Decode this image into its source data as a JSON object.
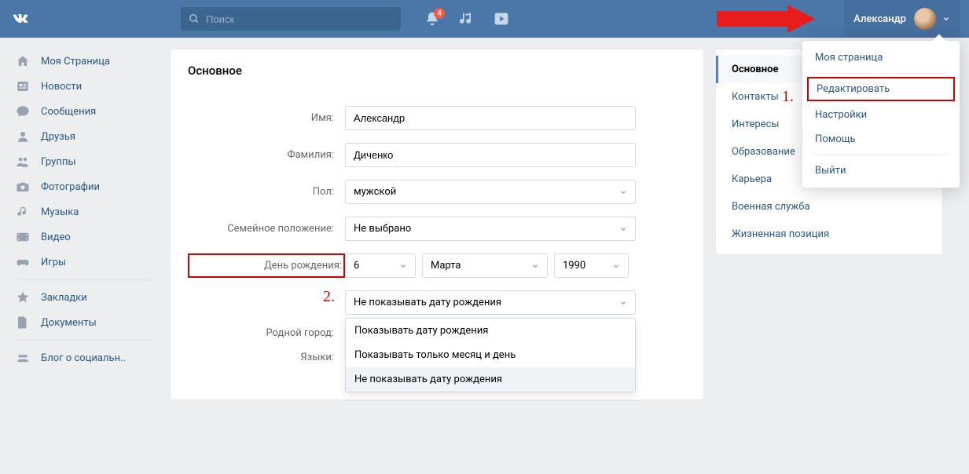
{
  "header": {
    "search_placeholder": "Поиск",
    "notif_count": "4",
    "user_name": "Александр"
  },
  "leftnav": {
    "items": [
      {
        "label": "Моя Страница",
        "icon": "home"
      },
      {
        "label": "Новости",
        "icon": "news"
      },
      {
        "label": "Сообщения",
        "icon": "messages"
      },
      {
        "label": "Друзья",
        "icon": "friends"
      },
      {
        "label": "Группы",
        "icon": "groups"
      },
      {
        "label": "Фотографии",
        "icon": "photos"
      },
      {
        "label": "Музыка",
        "icon": "music"
      },
      {
        "label": "Видео",
        "icon": "video"
      },
      {
        "label": "Игры",
        "icon": "games"
      }
    ],
    "items2": [
      {
        "label": "Закладки",
        "icon": "bookmarks"
      },
      {
        "label": "Документы",
        "icon": "docs"
      }
    ],
    "items3": [
      {
        "label": "Блог о социальн..",
        "icon": "blog"
      }
    ]
  },
  "main": {
    "title": "Основное",
    "labels": {
      "name": "Имя:",
      "surname": "Фамилия:",
      "gender": "Пол:",
      "relationship": "Семейное положение:",
      "birthday": "День рождения:",
      "hometown": "Родной город:",
      "languages": "Языки:"
    },
    "values": {
      "name": "Александр",
      "surname": "Диченко",
      "gender": "мужской",
      "relationship": "Не выбрано",
      "birth_day": "6",
      "birth_month": "Марта",
      "birth_year": "1990",
      "birth_visibility": "Не показывать дату рождения"
    },
    "dropdown_options": [
      "Показывать дату рождения",
      "Показывать только месяц и день",
      "Не показывать дату рождения"
    ]
  },
  "rightnav": {
    "items": [
      "Основное",
      "Контакты",
      "Интересы",
      "Образование",
      "Карьера",
      "Военная служба",
      "Жизненная позиция"
    ]
  },
  "user_dropdown": {
    "items": [
      "Моя страница",
      "Редактировать",
      "Настройки",
      "Помощь",
      "Выйти"
    ]
  },
  "annotations": {
    "one": "1.",
    "two": "2."
  }
}
